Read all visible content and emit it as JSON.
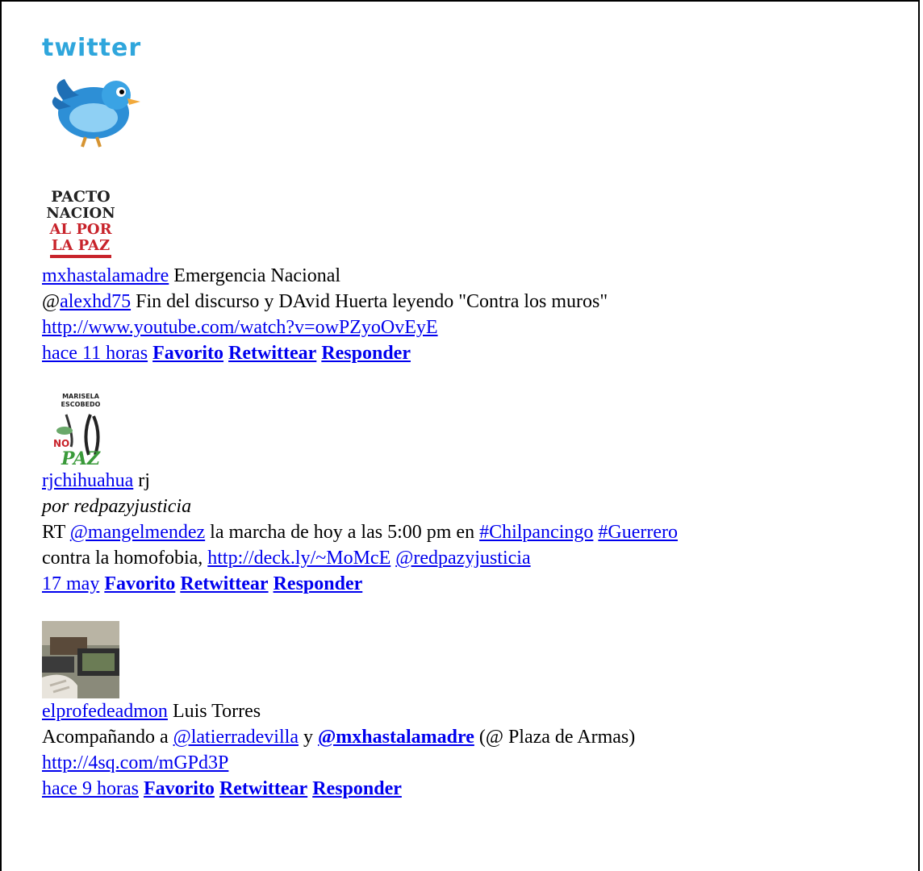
{
  "logo": {
    "text": "twitter",
    "icon": "bird-icon"
  },
  "tweets": [
    {
      "prefix": "»",
      "avatar": "pacto-nacional-por-la-paz-avatar",
      "avatar_text": [
        "PACTO",
        "NACION",
        "AL POR",
        "LA PAZ"
      ],
      "user": "mxhastalamadre",
      "name": "Emergencia Nacional",
      "via": "",
      "text_parts": {
        "at": "@",
        "mention": "alexhd75",
        "body": " Fin del discurso y DAvid Huerta leyendo \"Contra los muros\"",
        "link": "http://www.youtube.com/watch?v=owPZyoOvEyE"
      },
      "time": "hace 11 horas",
      "actions": [
        "Favorito",
        "Retwittear",
        "Responder"
      ]
    },
    {
      "avatar": "marisela-escobedo-paz-avatar",
      "avatar_text": [
        "MARISELA",
        "ESCOBEDO",
        "NO",
        "PAZ"
      ],
      "user": "rjchihuahua",
      "name": "rj",
      "via": "por redpazyjusticia",
      "text_parts": {
        "rt": "RT ",
        "mention": "@mangelmendez",
        "body1": " la marcha de hoy a las 5:00 pm en ",
        "hashtag1": "#Chilpancingo",
        "hashtag2": "#Guerrero",
        "body2": "contra la homofobia, ",
        "link": "http://deck.ly/~MoMcE",
        "mention2": "@redpazyjusticia"
      },
      "time": "17 may",
      "actions": [
        "Favorito",
        "Retwittear",
        "Responder"
      ]
    },
    {
      "avatar": "photo-avatar",
      "user": "elprofedeadmon",
      "name": "Luis Torres",
      "via": "",
      "text_parts": {
        "body1": "Acompañando a ",
        "mention1": "@latierradevilla",
        "y": " y ",
        "mention2": "@mxhastalamadre",
        "body2": " (@ Plaza de Armas)",
        "link": "http://4sq.com/mGPd3P"
      },
      "time": "hace 9 horas",
      "actions": [
        "Favorito",
        "Retwittear",
        "Responder"
      ]
    }
  ]
}
